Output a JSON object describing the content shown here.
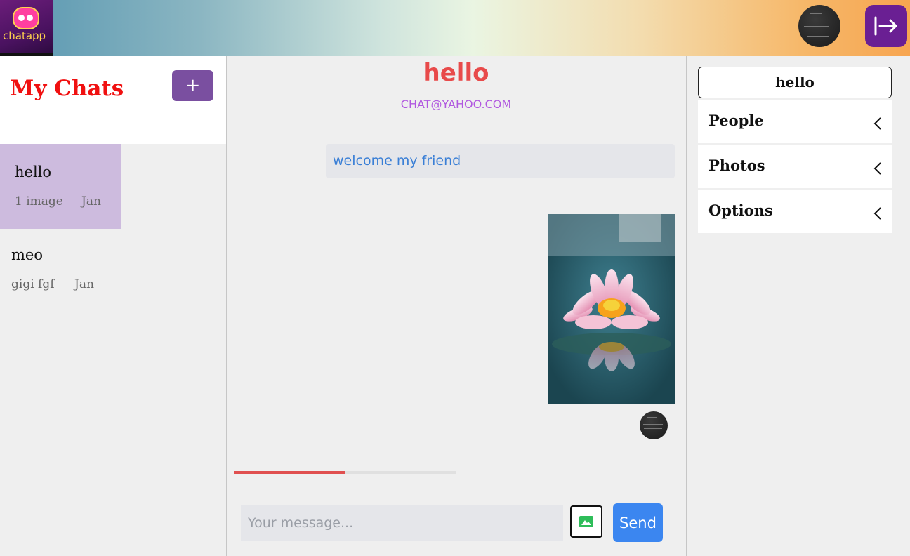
{
  "header": {
    "logo_text": "chatapp",
    "avatar_icon": "user-avatar",
    "logout_icon": "logout-arrow-icon"
  },
  "sidebar": {
    "title": "My Chats",
    "new_chat_label": "+",
    "chats": [
      {
        "name": "hello",
        "preview": "1 image",
        "date": "Jan",
        "active": true
      },
      {
        "name": "meo",
        "preview": "gigi fgf",
        "date": "Jan",
        "active": false
      }
    ]
  },
  "chat": {
    "title": "hello",
    "email": "CHAT@YAHOO.COM",
    "messages": [
      {
        "type": "text",
        "text": "welcome my friend"
      },
      {
        "type": "image",
        "image_icon": "lotus-flower-image"
      }
    ],
    "upload_progress": 0.5,
    "input_placeholder": "Your message...",
    "image_button_icon": "image-icon",
    "send_label": "Send"
  },
  "details": {
    "name": "hello",
    "sections": [
      "People",
      "Photos",
      "Options"
    ]
  },
  "colors": {
    "accent_purple": "#7a4fa0",
    "title_red": "#f01010",
    "send_blue": "#3b86f0",
    "message_blue": "#3a7fd6"
  }
}
